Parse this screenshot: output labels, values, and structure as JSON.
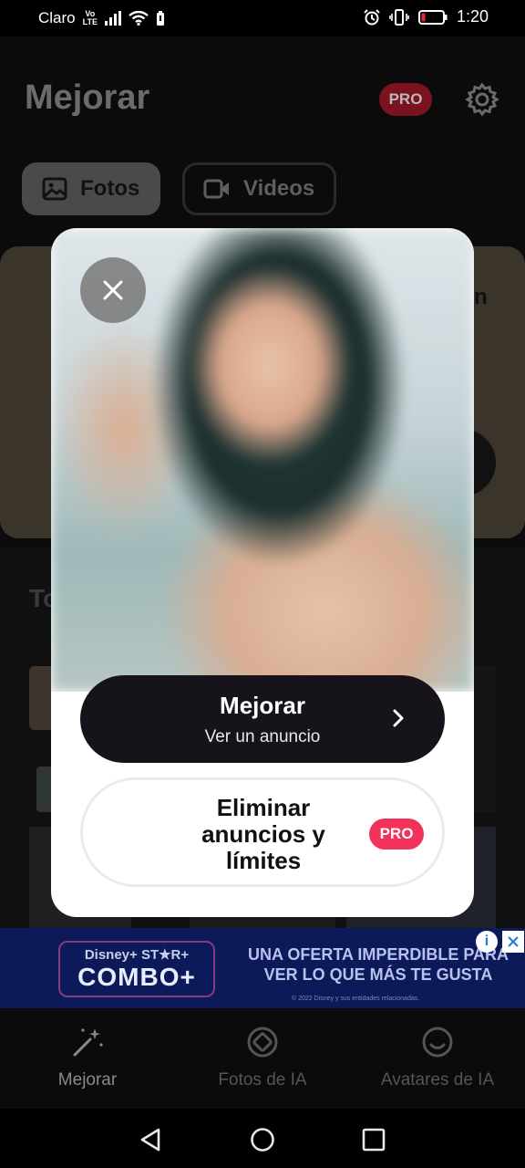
{
  "status_bar": {
    "carrier": "Claro",
    "network": [
      "Vo",
      "LTE"
    ],
    "time": "1:20"
  },
  "header": {
    "title": "Mejorar",
    "pro_badge": "PRO"
  },
  "tabs": [
    {
      "label": "Fotos"
    },
    {
      "label": "Videos"
    }
  ],
  "background": {
    "card_partial_text": "n",
    "section_partial_label": "To"
  },
  "modal": {
    "primary_button": {
      "label": "Mejorar",
      "sublabel": "Ver un anuncio"
    },
    "secondary_button": {
      "label": "Eliminar anuncios y límites",
      "badge": "PRO"
    }
  },
  "ad": {
    "logo_line1": "Disney+ ST★R+",
    "logo_line2": "COMBO+",
    "headline": "UNA OFERTA IMPERDIBLE PARA VER LO QUE MÁS TE GUSTA",
    "fine_print": "© 2022 Disney y sus entidades relacionadas."
  },
  "bottom_nav": [
    {
      "label": "Mejorar",
      "icon": "magic-wand-icon",
      "active": true
    },
    {
      "label": "Fotos de IA",
      "icon": "ai-photos-icon",
      "active": false
    },
    {
      "label": "Avatares de IA",
      "icon": "smiley-avatar-icon",
      "active": false
    }
  ],
  "colors": {
    "pro_red": "#f2325a",
    "button_dark": "#16141a",
    "ad_blue": "#0c1a5a"
  }
}
